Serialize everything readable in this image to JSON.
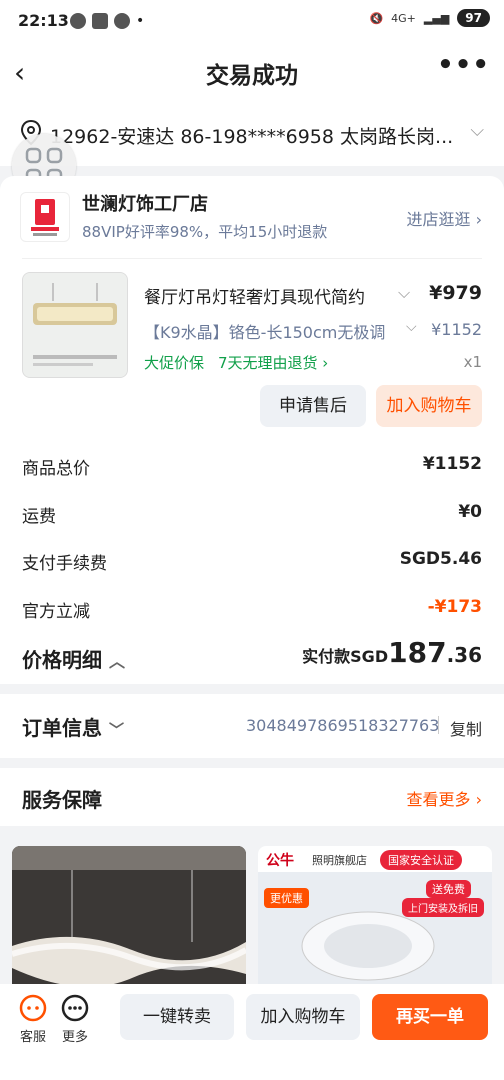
{
  "status_bar": {
    "time": "22:13",
    "dot": "•",
    "network": "4G+",
    "battery": "97"
  },
  "nav": {
    "title": "交易成功",
    "back_icon": "‹",
    "more_icon": "•••"
  },
  "address": {
    "text": "12962-安速达 86-198****6958 太岗路长岗..."
  },
  "shop": {
    "name": "世澜灯饰工厂店",
    "rating": "88VIP好评率98%，平均15小时退款",
    "visit_label": "进店逛逛"
  },
  "product": {
    "title": "餐厅灯吊灯轻奢灯具现代简约",
    "price": "¥979",
    "spec": "【K9水晶】铬色-长150cm无极调",
    "orig_price": "¥1152",
    "guarantee1": "大促价保",
    "guarantee2": "7天无理由退货 ›",
    "qty": "x1",
    "after_sale_label": "申请售后",
    "add_cart_label": "加入购物车"
  },
  "summary": {
    "rows": [
      {
        "label": "商品总价",
        "value": "¥1152"
      },
      {
        "label": "运费",
        "value": "¥0"
      },
      {
        "label": "支付手续费",
        "value": "SGD5.46"
      },
      {
        "label": "官方立减",
        "value": "-¥173"
      }
    ],
    "detail_label": "价格明细",
    "paid_prefix": "实付款SGD",
    "paid_int": "187",
    "paid_dec": ".36"
  },
  "order": {
    "label": "订单信息",
    "number": "3048497869518327763",
    "copy_label": "复制"
  },
  "service": {
    "label": "服务保障",
    "more_label": "查看更多 ›"
  },
  "recommend": {
    "brand": "公牛",
    "store_badge": "照明旗舰店",
    "safety_badge": "国家安全认证",
    "promo1": "送免费",
    "promo2": "上门安装及拆旧",
    "tag": "更优惠"
  },
  "bottom_bar": {
    "service_label": "客服",
    "more_label": "更多",
    "resell_label": "一键转卖",
    "add_cart_label": "加入购物车",
    "rebuy_label": "再买一单"
  },
  "colors": {
    "accent": "#ff5000",
    "green": "#11a04a",
    "blue_grey": "#6b7a99"
  }
}
